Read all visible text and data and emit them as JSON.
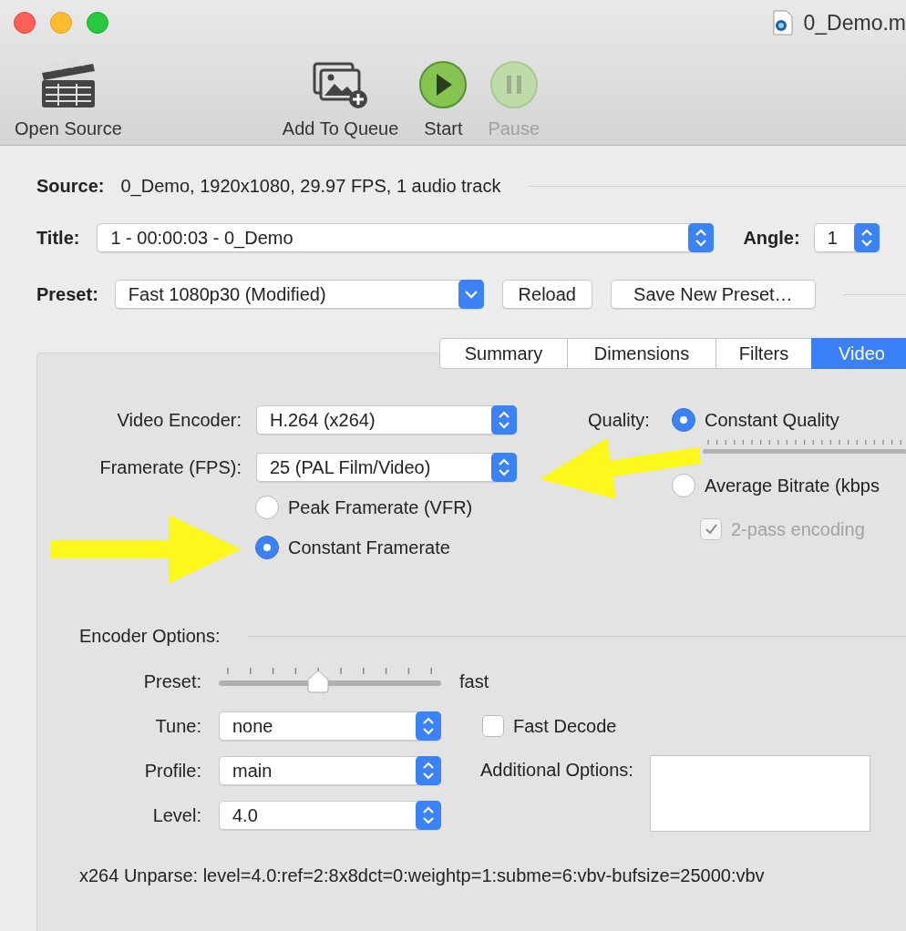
{
  "window": {
    "title": "0_Demo.m"
  },
  "toolbar": [
    {
      "kind": "clapper",
      "label": "Open Source",
      "disabled": false
    },
    {
      "kind": "queue",
      "label": "Add To Queue",
      "disabled": false
    },
    {
      "kind": "start",
      "label": "Start",
      "disabled": false
    },
    {
      "kind": "pause",
      "label": "Pause",
      "disabled": true
    }
  ],
  "source": {
    "label": "Source:",
    "value": "0_Demo, 1920x1080, 29.97 FPS, 1 audio track"
  },
  "title": {
    "label": "Title:",
    "value": "1 - 00:00:03 - 0_Demo"
  },
  "angle": {
    "label": "Angle:",
    "value": "1"
  },
  "preset": {
    "label": "Preset:",
    "value": "Fast 1080p30 (Modified)",
    "buttons": [
      "Reload",
      "Save New Preset…"
    ]
  },
  "tabs": [
    {
      "label": "Summary",
      "selected": false
    },
    {
      "label": "Dimensions",
      "selected": false
    },
    {
      "label": "Filters",
      "selected": false
    },
    {
      "label": "Video",
      "selected": true
    }
  ],
  "video": {
    "encoder": {
      "label": "Video Encoder:",
      "value": "H.264 (x264)"
    },
    "framerate": {
      "label": "Framerate (FPS):",
      "value": "25 (PAL Film/Video)"
    },
    "framerate_modes": [
      {
        "label": "Peak Framerate (VFR)",
        "selected": false
      },
      {
        "label": "Constant Framerate",
        "selected": true
      }
    ],
    "quality": {
      "label": "Quality:",
      "modes": [
        {
          "label": "Constant Quality",
          "selected": true
        },
        {
          "label": "Average Bitrate (kbps",
          "selected": false
        }
      ],
      "two_pass": {
        "label": "2-pass encoding",
        "checked": true,
        "disabled": true
      }
    }
  },
  "encoder_options": {
    "heading": "Encoder Options:",
    "preset": {
      "label": "Preset:",
      "level": 0.444,
      "value": "fast"
    },
    "tune": {
      "label": "Tune:",
      "value": "none"
    },
    "fast_decode": {
      "label": "Fast Decode",
      "checked": false
    },
    "profile": {
      "label": "Profile:",
      "value": "main"
    },
    "additional": {
      "label": "Additional Options:"
    },
    "level": {
      "label": "Level:",
      "value": "4.0"
    },
    "unparse": "x264 Unparse: level=4.0:ref=2:8x8dct=0:weightp=1:subme=6:vbv-bufsize=25000:vbv"
  }
}
